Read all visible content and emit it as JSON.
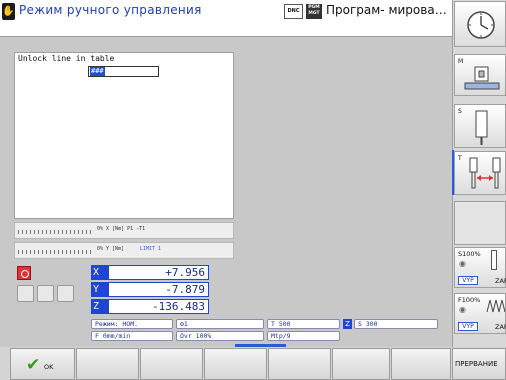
{
  "header": {
    "mode_title": "Режим ручного управления",
    "dnc_label": "DNC",
    "pgm_label": "PGM MGT",
    "program_title": "Програм- мирован…"
  },
  "table_window": {
    "caption": "Unlock line in table",
    "input_value": "###"
  },
  "overrides": {
    "feed_text": "0% X [Nm]  P1  -T1",
    "spindle_text": "0% Y [Nm]",
    "spindle_limit": "LIMIT 1"
  },
  "axes": [
    {
      "letter": "X",
      "value": "+7.956"
    },
    {
      "letter": "Y",
      "value": "-7.879"
    },
    {
      "letter": "Z",
      "value": "-136.483"
    }
  ],
  "status": {
    "mode": "Режим: НОМ.",
    "tool_icon_num": "1",
    "tool": "T 500",
    "spindle_axis": "Z",
    "spindle_speed": "S 300",
    "feed": "F 0mm/min",
    "override": "Ovr 100%",
    "mfunc": "Mtp/9"
  },
  "softkeys": {
    "ok_label": "OK",
    "cancel_label": "ПРЕРВАНИЕ"
  },
  "sidebar": {
    "m_key": "M",
    "s_key": "S",
    "t_key": "T",
    "s_override": "S100%",
    "f_override": "F100%",
    "vyp1": "VYP",
    "zap1": "ZAP",
    "vyp2": "VYP",
    "zap2": "ZAP"
  },
  "colors": {
    "accent": "#1e46d2",
    "stop": "#e0303a",
    "ok": "#3a9a1a"
  }
}
